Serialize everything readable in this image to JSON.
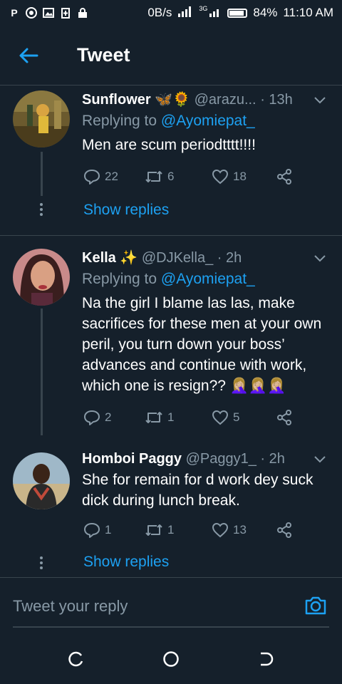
{
  "status_bar": {
    "left_icons": [
      "P",
      "chrome-icon",
      "image-icon",
      "battery-saver-icon",
      "lock-icon"
    ],
    "speed": "0B/s",
    "network": "3G",
    "battery": "84%",
    "time": "11:10 AM"
  },
  "header": {
    "title": "Tweet"
  },
  "tweets": [
    {
      "name": "Sunflower",
      "emojis": "🦋🌻",
      "handle": "@arazu...",
      "time": "· 13h",
      "replying_to_label": "Replying to",
      "replying_to": "@Ayomiepat_",
      "text": "Men are scum periodtttt!!!!",
      "replies": "22",
      "retweets": "6",
      "likes": "18",
      "show_replies": "Show replies"
    },
    {
      "name": "Kella",
      "emojis": "✨",
      "handle": "@DJKella_",
      "time": "· 2h",
      "replying_to_label": "Replying to",
      "replying_to": "@Ayomiepat_",
      "text": "Na the girl I blame las las, make sacrifices for these men at your own peril, you turn down your boss’ advances and continue with work, which one is resign?? 🤦🏼‍♀️🤦🏼‍♀️🤦🏼‍♀️",
      "replies": "2",
      "retweets": "1",
      "likes": "5"
    },
    {
      "name": "Homboi Paggy",
      "handle": "@Paggy1_",
      "time": "· 2h",
      "text": "She for remain for d work dey suck dick during lunch break.",
      "replies": "1",
      "retweets": "1",
      "likes": "13",
      "show_replies": "Show replies"
    }
  ],
  "reply_bar": {
    "placeholder": "Tweet your reply"
  },
  "colors": {
    "background": "#15202b",
    "accent": "#1da1f2",
    "muted": "#8899a6",
    "divider": "#38444d"
  }
}
